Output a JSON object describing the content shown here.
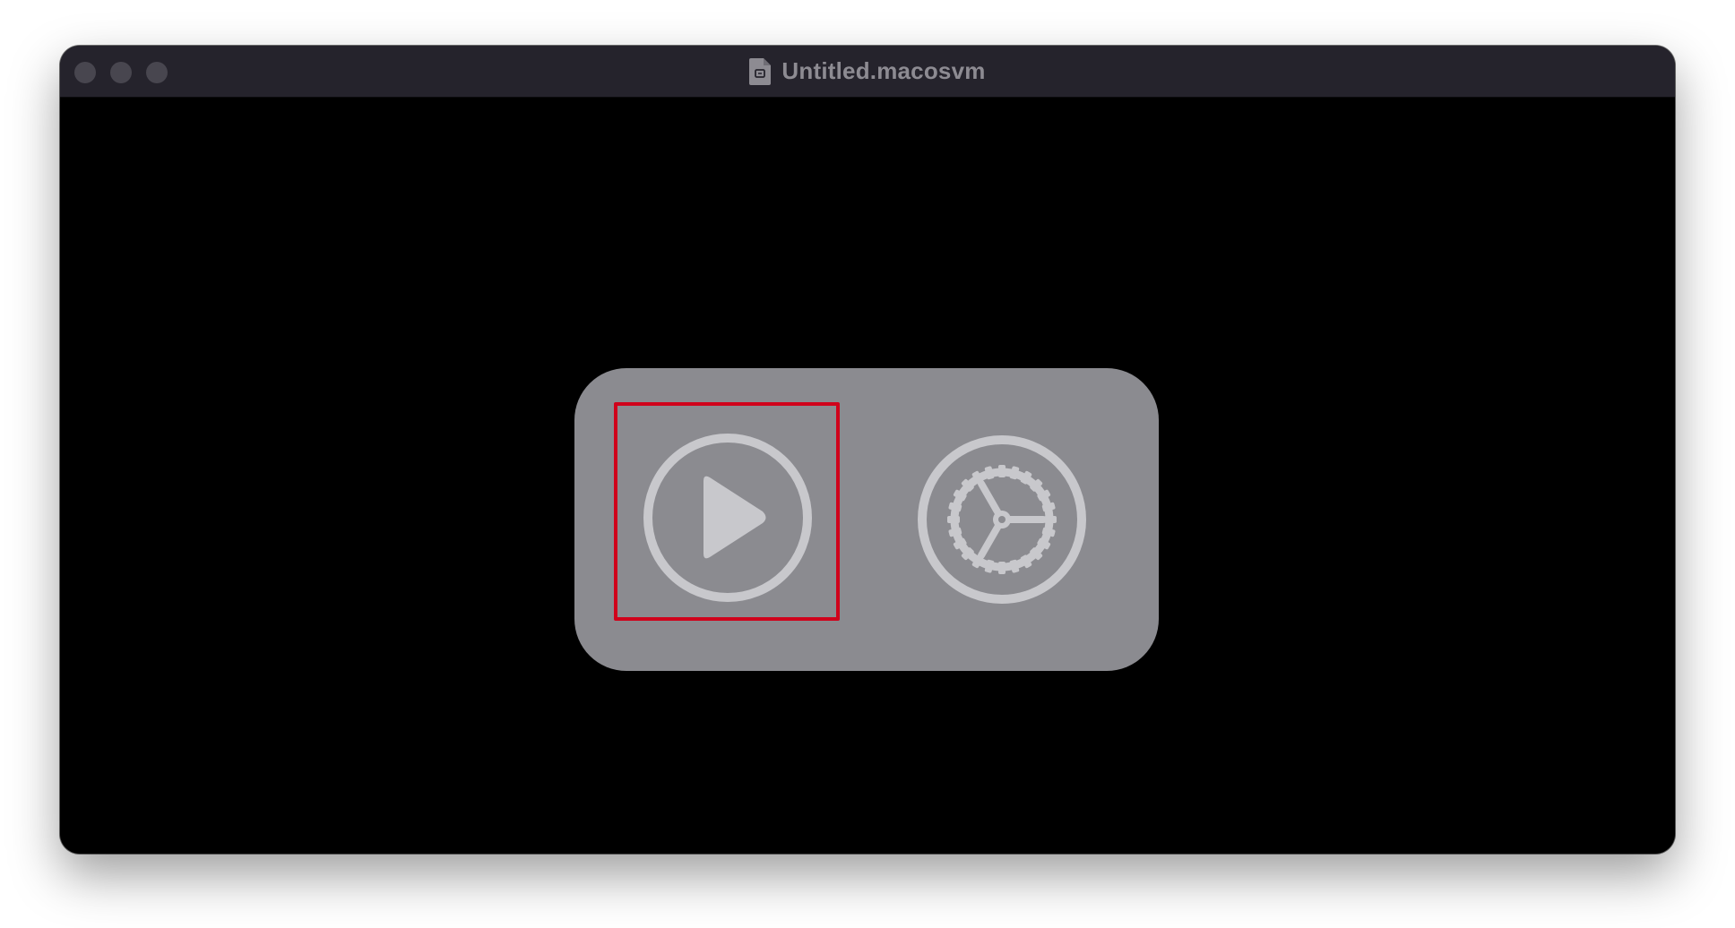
{
  "window": {
    "title": "Untitled.macosvm",
    "document_icon": "document-icon",
    "controls": [
      "close",
      "minimize",
      "zoom"
    ]
  },
  "vm_controls": {
    "play": {
      "icon": "play-circle-icon",
      "highlighted": true,
      "highlight_color": "#d0021b"
    },
    "settings": {
      "icon": "gear-circle-icon"
    }
  },
  "colors": {
    "panel": "#8b8b90",
    "icon": "#c8c8cc",
    "titlebar": "#25232c",
    "title_text": "#8d8b92"
  }
}
